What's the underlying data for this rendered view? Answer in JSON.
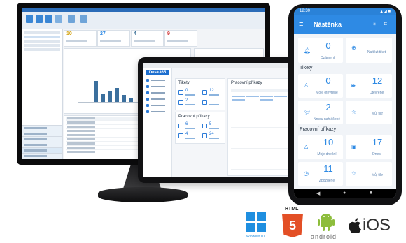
{
  "phone": {
    "time": "12:30",
    "signal": "▲◢ ■",
    "app_title": "Nástěnka",
    "menu_icon": "menu-icon",
    "top_tiles": [
      {
        "icon": "bell-icon",
        "count": "0",
        "label": "Ozámení"
      },
      {
        "icon": "search-plus-icon",
        "count": "",
        "label": "Naltézt tiket"
      }
    ],
    "tickets_section": "Tikety",
    "ticket_tiles": [
      {
        "icon": "user-icon",
        "count": "0",
        "label": "Moje otevřené"
      },
      {
        "icon": "forward-icon",
        "count": "12",
        "label": "Otevřené"
      },
      {
        "icon": "chat-icon",
        "count": "2",
        "label": "Nrnou nahlášené"
      },
      {
        "icon": "star-icon",
        "count": "",
        "label": "Můj filtr"
      }
    ],
    "work_section": "Pracovní příkazy",
    "work_tiles": [
      {
        "icon": "user-icon",
        "count": "10",
        "label": "Moje dnešní"
      },
      {
        "icon": "calendar-icon",
        "count": "17",
        "label": "Dnes"
      },
      {
        "icon": "clock-icon",
        "count": "11",
        "label": "Zpožděné"
      },
      {
        "icon": "star-icon",
        "count": "",
        "label": "Můj filtr"
      }
    ],
    "nav": [
      "◀",
      "●",
      "■"
    ]
  },
  "tablet": {
    "logo": "Desk365",
    "tickets_title": "Tikety",
    "work_title": "Pracovní příkazy",
    "calendar_title": "Pracovní příkazy"
  },
  "monitor": {
    "cards": [
      "10",
      "27",
      "4",
      "9"
    ]
  },
  "platforms": {
    "windows_label": "Windows10",
    "html_label": "HTML",
    "html_badge": "5",
    "android_label": "android",
    "ios_label": "iOS",
    "apple_icon": "apple-icon"
  },
  "colors": {
    "accent": "#2e8ae4",
    "html5": "#e34f26",
    "android": "#8dbd3c",
    "windows": "#1f8fe0"
  }
}
